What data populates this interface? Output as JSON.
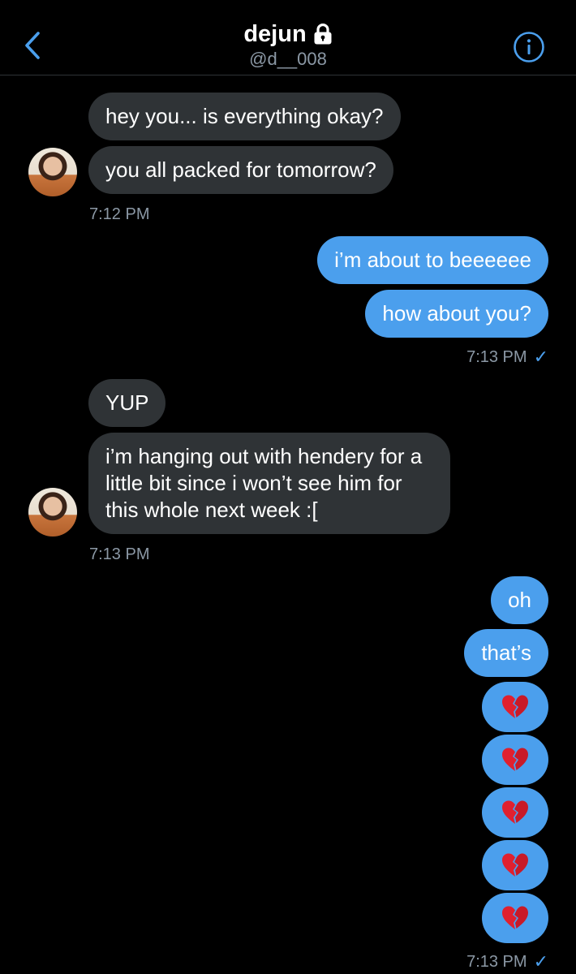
{
  "header": {
    "name": "dejun",
    "handle": "@d__008",
    "back_icon": "chevron-left-icon",
    "lock_icon": "lock-icon",
    "info_icon": "info-icon",
    "accent": "#4b9fed"
  },
  "messages": [
    {
      "side": "in",
      "text": "hey you... is everything okay?"
    },
    {
      "side": "in",
      "text": "you all packed for tomorrow?"
    },
    {
      "side": "out",
      "text": "i’m about to beeeeee"
    },
    {
      "side": "out",
      "text": "how about you?"
    },
    {
      "side": "in",
      "text": "YUP"
    },
    {
      "side": "in",
      "text": "i’m hanging out with hendery for a little bit since i won’t see him for this whole next week :["
    },
    {
      "side": "out",
      "text": "oh"
    },
    {
      "side": "out",
      "text": "that’s"
    },
    {
      "side": "out",
      "emoji": "broken-heart-icon"
    },
    {
      "side": "out",
      "emoji": "broken-heart-icon"
    },
    {
      "side": "out",
      "emoji": "broken-heart-icon"
    },
    {
      "side": "out",
      "emoji": "broken-heart-icon"
    },
    {
      "side": "out",
      "emoji": "broken-heart-icon"
    }
  ],
  "timestamps": {
    "t1": "7:12 PM",
    "t2": "7:13 PM",
    "t3": "7:13 PM",
    "t4": "7:13 PM",
    "read_mark": "✓"
  },
  "colors": {
    "background": "#000000",
    "incoming_bubble": "#2f3336",
    "outgoing_bubble": "#4b9fed",
    "muted_text": "#8b98a5",
    "heart_red": "#e0202f"
  }
}
